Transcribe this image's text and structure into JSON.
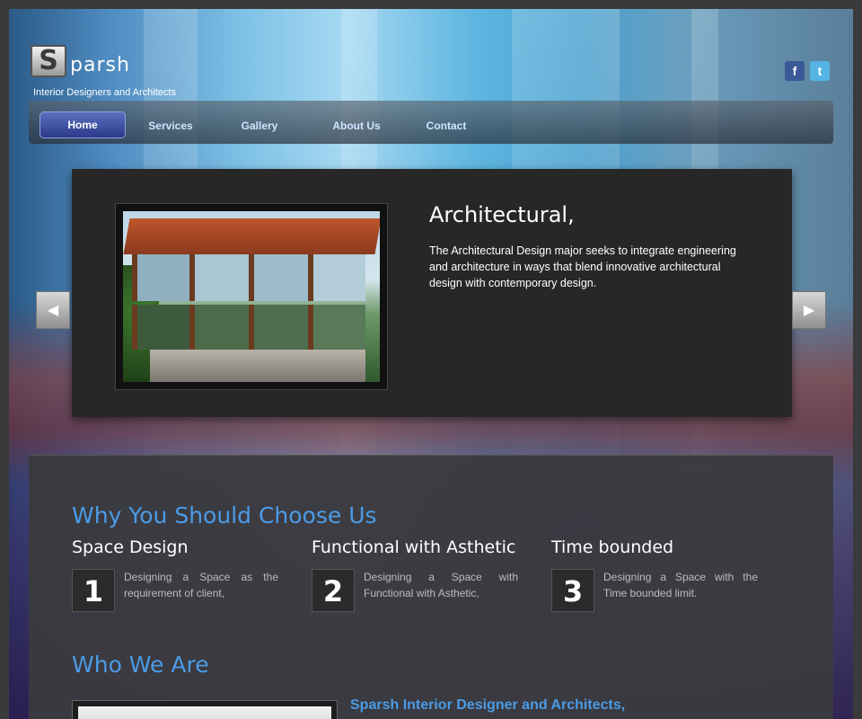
{
  "header": {
    "logo_letter": "S",
    "logo_text": "parsh",
    "tagline": "Interior Designers and Architects",
    "social": {
      "facebook_glyph": "f",
      "twitter_glyph": "t"
    }
  },
  "nav": {
    "items": [
      "Home",
      "Services",
      "Gallery",
      "About Us",
      "Contact"
    ]
  },
  "slider": {
    "title": "Architectural,",
    "text": "The Architectural Design major seeks to integrate engineering and architecture in ways that blend innovative architectural design with contemporary design.",
    "prev_glyph": "◀",
    "next_glyph": "▶"
  },
  "why": {
    "heading": "Why You Should Choose Us",
    "features": [
      {
        "number": "1",
        "title": "Space Design",
        "desc": "Designing a Space as the requirement of client,"
      },
      {
        "number": "2",
        "title": "Functional with Asthetic",
        "desc": "Designing a Space with Functional with Asthetic,"
      },
      {
        "number": "3",
        "title": "Time bounded",
        "desc": "Designing a Space with the Time bounded limit."
      }
    ]
  },
  "who": {
    "heading": "Who We Are",
    "title": "Sparsh Interior Designer and Architects,"
  },
  "colors": {
    "accent_blue": "#4b9be6",
    "panel": "#272727",
    "nav_active": "#2c3a8a"
  },
  "icons": [
    "facebook-icon",
    "twitter-icon",
    "arrow-left-icon",
    "arrow-right-icon"
  ]
}
